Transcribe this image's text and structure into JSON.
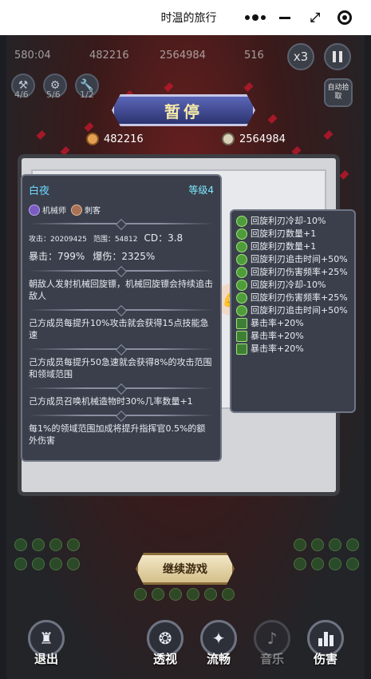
{
  "window": {
    "title": "时温的旅行"
  },
  "hud": {
    "timer": "580:04",
    "gold": "482216",
    "kills": "2564984",
    "wave": "516",
    "speed": "x3",
    "auto_pickup": "自动拾取",
    "skills": [
      {
        "count": "4/6",
        "icon": "hammer-icon"
      },
      {
        "count": "5/6",
        "icon": "gear-icon"
      },
      {
        "count": "1/2",
        "icon": "wrench-icon"
      }
    ]
  },
  "pause": {
    "banner": "暂停",
    "gold": "482216",
    "kills": "2564984"
  },
  "character": {
    "name": "白夜",
    "level": "等级4",
    "tags": [
      "机械师",
      "刺客"
    ],
    "attack": "攻击：20209425",
    "range": "范围：54812",
    "cd": "CD：3.8",
    "crit_rate": "暴击：799%",
    "crit_damage": "爆伤：2325%",
    "descriptions": [
      "朝敌人发射机械回旋镖，机械回旋镖会持续追击敌人",
      "己方成员每提升10%攻击就会获得15点技能急速",
      "己方成员每提升50急速就会获得8%的攻击范围和领域范围",
      "己方成员召唤机械造物时30%几率数量+1",
      "每1%的领域范围加成将提升指挥官0.5%的额外伤害"
    ]
  },
  "bonuses": [
    {
      "text": "回旋利刃冷却-10%",
      "icon": "boomerang-icon"
    },
    {
      "text": "回旋利刃数量+1",
      "icon": "boomerang-icon"
    },
    {
      "text": "回旋利刃数量+1",
      "icon": "boomerang-icon"
    },
    {
      "text": "回旋利刃追击时间+50%",
      "icon": "boomerang-icon"
    },
    {
      "text": "回旋利刃伤害频率+25%",
      "icon": "boomerang-icon"
    },
    {
      "text": "回旋利刃冷却-10%",
      "icon": "boomerang-icon"
    },
    {
      "text": "回旋利刃伤害频率+25%",
      "icon": "boomerang-icon"
    },
    {
      "text": "回旋利刃追击时间+50%",
      "icon": "boomerang-icon"
    },
    {
      "text": "暴击率+20%",
      "icon": "crit-icon"
    },
    {
      "text": "暴击率+20%",
      "icon": "crit-icon"
    },
    {
      "text": "暴击率+20%",
      "icon": "crit-icon"
    }
  ],
  "continue_label": "继续游戏",
  "toolbar": {
    "exit": "退出",
    "reveal": "透视",
    "smooth": "流畅",
    "music": "音乐",
    "damage": "伤害"
  },
  "colors": {
    "accent_cyan": "#6fd6ff",
    "banner_blue": "#3b44a0",
    "button_gold": "#d4bf8a",
    "panel_dark": "#3a3f4b"
  }
}
